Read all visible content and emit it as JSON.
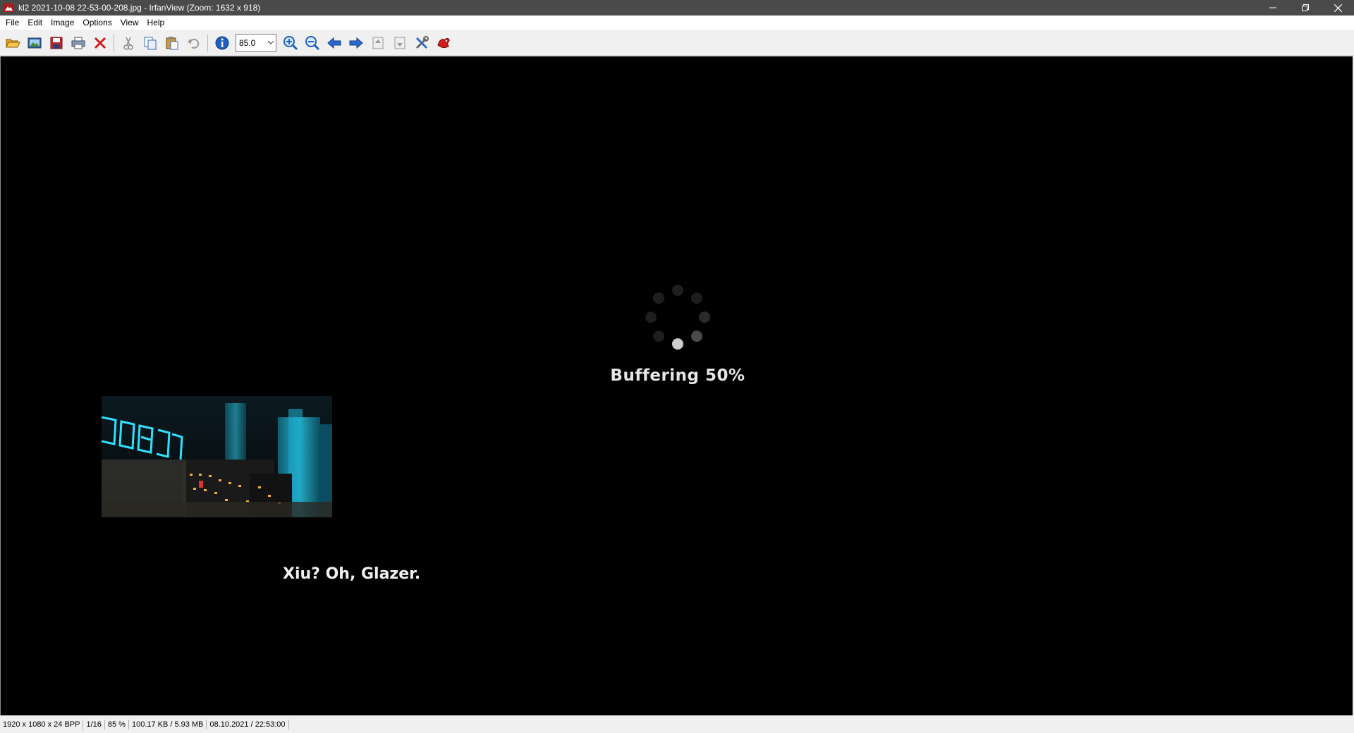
{
  "window": {
    "title": "kl2 2021-10-08 22-53-00-208.jpg - IrfanView (Zoom: 1632 x 918)",
    "controls": {
      "minimize": "—",
      "restore": "❐",
      "close": "✕"
    }
  },
  "menu": {
    "items": [
      {
        "label": "File"
      },
      {
        "label": "Edit"
      },
      {
        "label": "Image"
      },
      {
        "label": "Options"
      },
      {
        "label": "View"
      },
      {
        "label": "Help"
      }
    ]
  },
  "toolbar": {
    "buttons": [
      {
        "icon": "open-folder-icon"
      },
      {
        "icon": "slideshow-icon"
      },
      {
        "icon": "save-icon"
      },
      {
        "icon": "print-icon"
      },
      {
        "icon": "delete-icon"
      },
      {
        "icon": "cut-icon"
      },
      {
        "icon": "copy-icon"
      },
      {
        "icon": "paste-icon"
      },
      {
        "icon": "undo-icon"
      },
      {
        "icon": "info-icon"
      },
      {
        "icon": "zoom-in-icon"
      },
      {
        "icon": "zoom-out-icon"
      },
      {
        "icon": "previous-arrow-icon"
      },
      {
        "icon": "next-arrow-icon"
      },
      {
        "icon": "page-up-icon"
      },
      {
        "icon": "page-down-icon"
      },
      {
        "icon": "settings-tools-icon"
      },
      {
        "icon": "irfanview-logo-icon"
      }
    ],
    "zoom_value": "85.0"
  },
  "viewer": {
    "buffering_text": "Buffering 50%",
    "buffering_progress": 50,
    "subtitle_text": "Xiu? Oh, Glazer."
  },
  "status": {
    "dimensions": "1920 x 1080 x 24 BPP",
    "index": "1/16",
    "zoom": "85 %",
    "size": "100.17 KB / 5.93 MB",
    "datetime": "08.10.2021 / 22:53:00"
  },
  "colors": {
    "titlebar": "#4a4a4a",
    "viewer_bg": "#000000",
    "text_light": "#e6e6e6",
    "neon_cyan": "#2fe0ff",
    "spinner_active": "#cfcfcf"
  }
}
